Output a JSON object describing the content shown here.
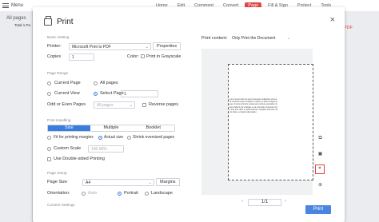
{
  "app": {
    "menu_label": "Menu",
    "tabs": [
      "Home",
      "Edit",
      "Comment",
      "Convert",
      "Page",
      "Fill & Sign",
      "Protect",
      "Tools"
    ],
    "active_tab": "Page",
    "left_panel_title": "All pages",
    "left_panel_sub": "Total 1 Pa",
    "right_panel_fragment": "PDF"
  },
  "dialog": {
    "title": "Print",
    "close_glyph": "×",
    "basic_setting": {
      "section": "Basic Setting",
      "printer_label": "Printer:",
      "printer_value": "Microsoft Print to PDF",
      "properties": "Properties",
      "copies_label": "Copies",
      "copies_value": "1",
      "color_label": "Color:",
      "grayscale_label": "Print in Grayscale"
    },
    "page_range": {
      "section": "Page Range",
      "current_page": "Current Page",
      "all_pages": "All pages",
      "current_view": "Current View",
      "select_page": "Select Page",
      "select_value": "1",
      "odd_even_label": "Odd or Even Pages",
      "odd_even_value": "All pages",
      "reverse": "Reverse pages"
    },
    "print_handling": {
      "section": "Print Handling",
      "modes": [
        "Size",
        "Multiple",
        "Booklet"
      ],
      "active_mode": "Size",
      "fit": "Fit for printing margins",
      "actual": "Actual size",
      "shrink": "Shrink oversized pages",
      "custom_scale": "Custom Scale",
      "custom_value": "100.00%",
      "duplex": "Use Double-sided Printing"
    },
    "page_setup": {
      "section": "Page Setup",
      "size_label": "Page Size",
      "size_value": "A4",
      "margins": "Margins",
      "orientation_label": "Orientation:",
      "auto": "Auto",
      "portrait": "Portrait",
      "landscape": "Landscape"
    },
    "content_settings_label": "Content Settings",
    "preview": {
      "content_label": "Print content:",
      "content_value": "Only Print the Document",
      "page_text": "Lorem ipsum dolor sit amet consectetur adipiscing elit sed do eiusmod tempor incididunt ut labore et dolore magna aliqua. Ut enim ad minim veniam quis nostrud exercitation ullamco laboris nisi ut aliquip ex ea commodo consequat. Duis aute irure dolor in reprehenderit in voluptate velit esse cillum dolore eu fugiat nulla pariatur.",
      "pager": "1/1",
      "prev_glyph": "‹",
      "next_glyph": "›"
    },
    "print_button": "Print",
    "tool_icons": [
      "fit-page-icon",
      "page-view-icon",
      "crop-icon",
      "zoom-icon"
    ]
  }
}
